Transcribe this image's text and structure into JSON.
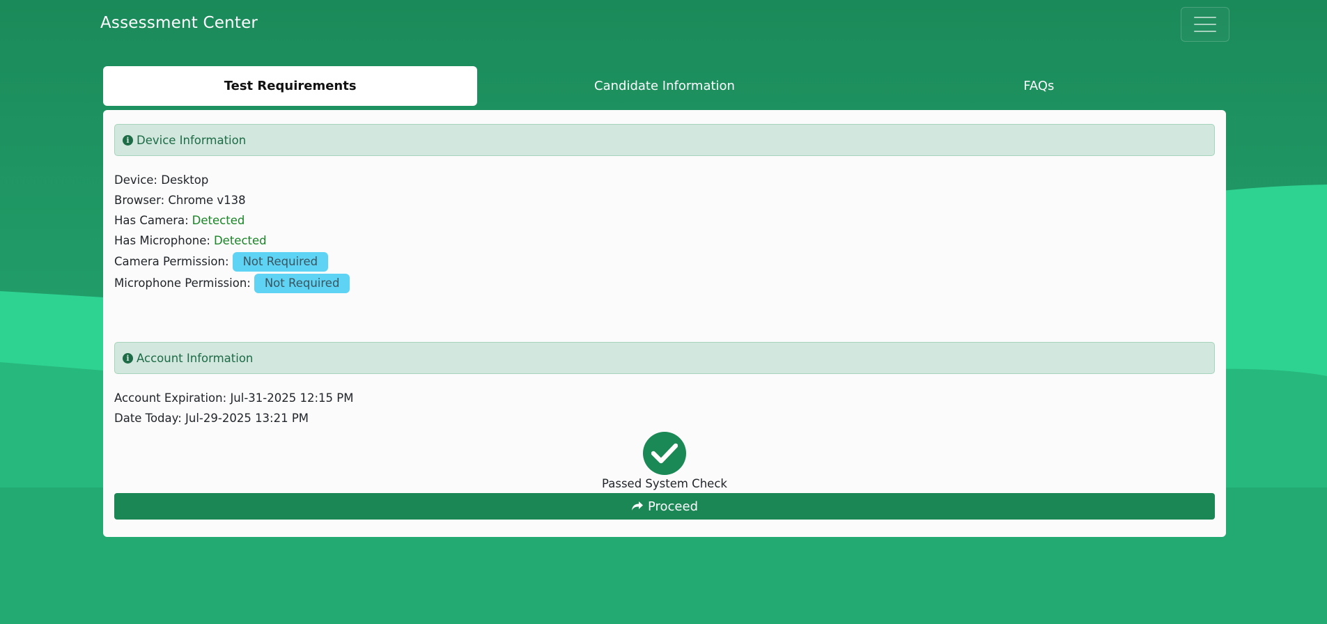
{
  "header": {
    "brand": "Assessment Center",
    "menu_icon": "hamburger-icon"
  },
  "tabs": [
    {
      "label": "Test Requirements",
      "active": true
    },
    {
      "label": "Candidate Information",
      "active": false
    },
    {
      "label": "FAQs",
      "active": false
    }
  ],
  "device_section": {
    "title": "Device Information",
    "icon": "info-icon",
    "device_label": "Device:",
    "device_value": "Desktop",
    "browser_label": "Browser:",
    "browser_value": "Chrome v138",
    "camera_label": "Has Camera:",
    "camera_value": "Detected",
    "microphone_label": "Has Microphone:",
    "microphone_value": "Detected",
    "camera_permission_label": "Camera Permission:",
    "camera_permission_value": "Not Required",
    "microphone_permission_label": "Microphone Permission:",
    "microphone_permission_value": "Not Required"
  },
  "account_section": {
    "title": "Account Information",
    "icon": "info-icon",
    "expiration_label": "Account Expiration:",
    "expiration_value": "Jul-31-2025 12:15 PM",
    "today_label": "Date Today:",
    "today_value": "Jul-29-2025 13:21 PM"
  },
  "system_check": {
    "icon": "check-circle-icon",
    "label": "Passed System Check"
  },
  "proceed": {
    "icon": "share-arrow-icon",
    "label": "Proceed"
  },
  "colors": {
    "brand_green": "#1a8755",
    "alert_bg": "#d2e7dd",
    "alert_text": "#1d6b47",
    "detected_text": "#198526",
    "pill_bg": "#5ed3f3"
  }
}
